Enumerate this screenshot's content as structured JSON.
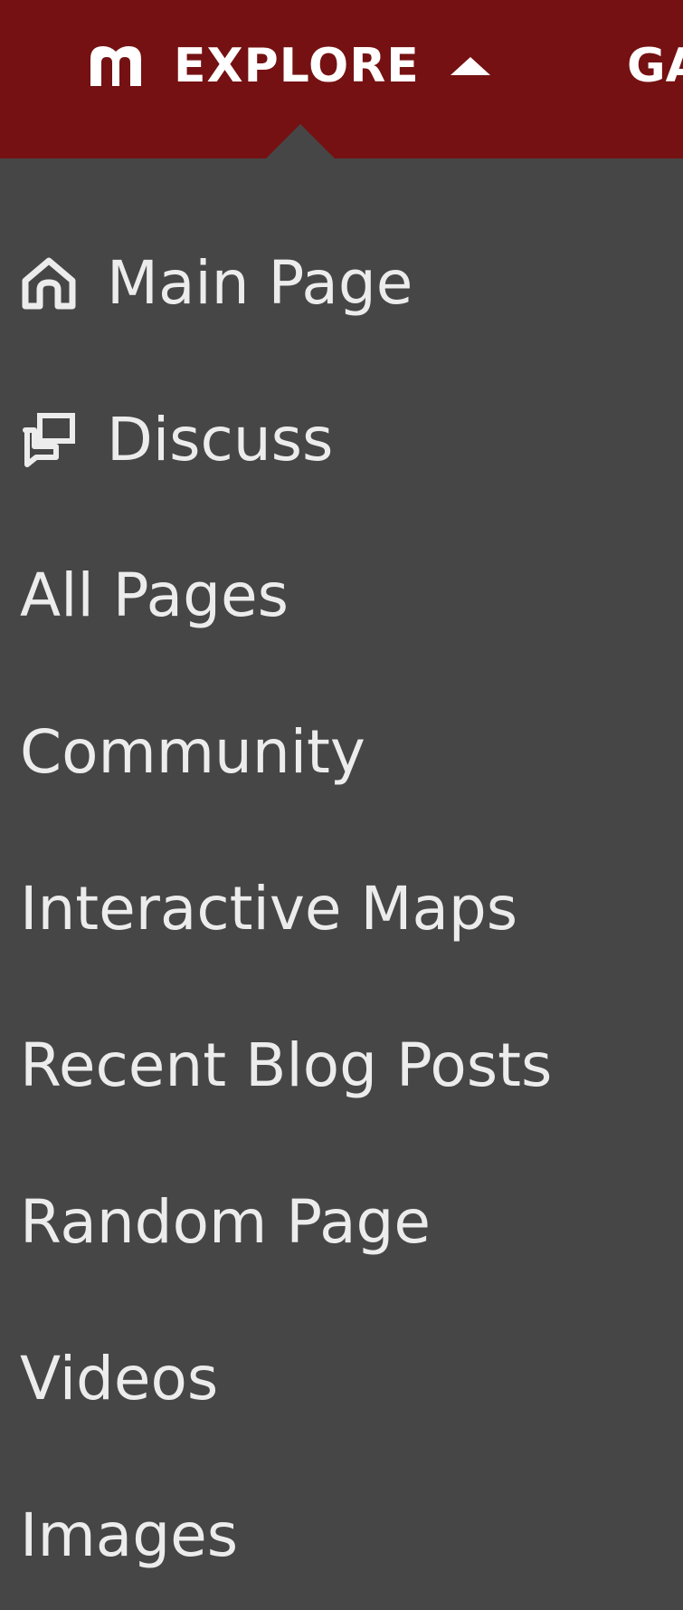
{
  "nav": {
    "explore": {
      "label": "EXPLORE",
      "icon": "explore-map-icon",
      "expanded": true
    },
    "next_label": "GA"
  },
  "colors": {
    "topbar_bg": "#751112",
    "menu_bg": "#464646",
    "menu_text": "#ececec"
  },
  "menu": {
    "items": [
      {
        "label": "Main Page",
        "icon": "home-icon"
      },
      {
        "label": "Discuss",
        "icon": "discussion-icon"
      },
      {
        "label": "All Pages"
      },
      {
        "label": "Community"
      },
      {
        "label": "Interactive Maps"
      },
      {
        "label": "Recent Blog Posts"
      },
      {
        "label": "Random Page"
      },
      {
        "label": "Videos"
      },
      {
        "label": "Images"
      }
    ]
  }
}
